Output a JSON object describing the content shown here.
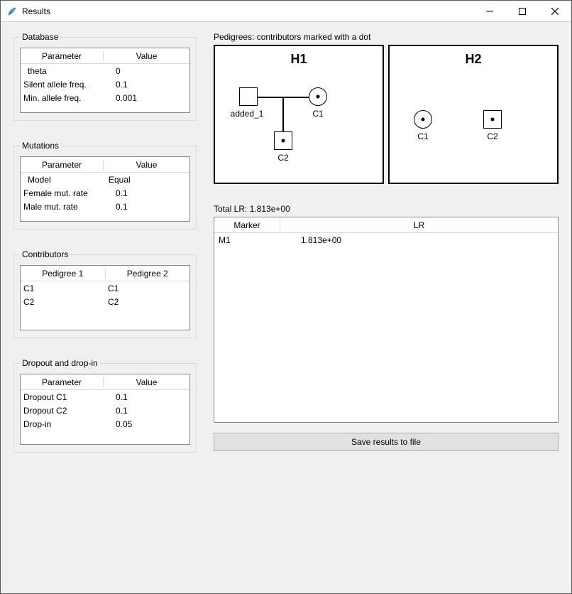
{
  "window": {
    "title": "Results"
  },
  "database": {
    "legend": "Database",
    "headers": {
      "param": "Parameter",
      "value": "Value"
    },
    "rows": [
      {
        "param": "theta",
        "value": "0"
      },
      {
        "param": "Silent allele freq.",
        "value": "0.1"
      },
      {
        "param": "Min. allele freq.",
        "value": "0.001"
      }
    ]
  },
  "mutations": {
    "legend": "Mutations",
    "headers": {
      "param": "Parameter",
      "value": "Value"
    },
    "rows": [
      {
        "param": "Model",
        "value": "Equal"
      },
      {
        "param": "Female mut. rate",
        "value": "0.1"
      },
      {
        "param": "Male mut. rate",
        "value": "0.1"
      }
    ]
  },
  "contributors": {
    "legend": "Contributors",
    "headers": {
      "ped1": "Pedigree 1",
      "ped2": "Pedigree 2"
    },
    "rows": [
      {
        "ped1": "C1",
        "ped2": "C1"
      },
      {
        "ped1": "C2",
        "ped2": "C2"
      }
    ]
  },
  "dropout": {
    "legend": "Dropout and drop-in",
    "headers": {
      "param": "Parameter",
      "value": "Value"
    },
    "rows": [
      {
        "param": "Dropout C1",
        "value": "0.1"
      },
      {
        "param": "Dropout C2",
        "value": "0.1"
      },
      {
        "param": "Drop-in",
        "value": "0.05"
      }
    ]
  },
  "pedigrees": {
    "label": "Pedigrees: contributors marked with a dot",
    "h1": {
      "title": "H1",
      "nodes": {
        "added_1": "added_1",
        "c1": "C1",
        "c2": "C2"
      }
    },
    "h2": {
      "title": "H2",
      "nodes": {
        "c1": "C1",
        "c2": "C2"
      }
    }
  },
  "lr": {
    "total_label": "Total LR: 1.813e+00",
    "headers": {
      "marker": "Marker",
      "lr": "LR"
    },
    "rows": [
      {
        "marker": "M1",
        "lr": "1.813e+00"
      }
    ]
  },
  "buttons": {
    "save": "Save results to file"
  }
}
